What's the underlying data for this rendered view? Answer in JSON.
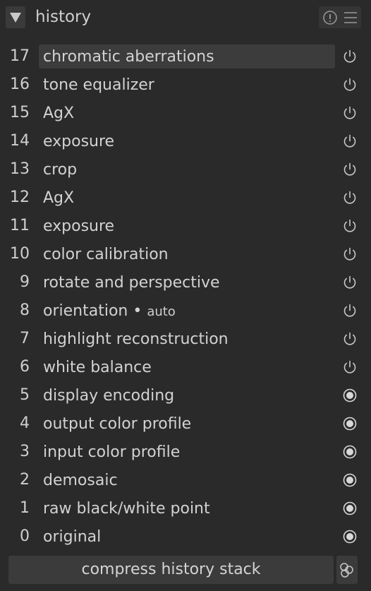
{
  "header": {
    "title": "history",
    "collapse_icon": "triangle-down-icon",
    "info_icon": "info-icon",
    "menu_icon": "hamburger-menu-icon"
  },
  "history": {
    "items": [
      {
        "num": "17",
        "label": "chromatic aberrations",
        "sub": "",
        "state": "power",
        "selected": true
      },
      {
        "num": "16",
        "label": "tone equalizer",
        "sub": "",
        "state": "power",
        "selected": false
      },
      {
        "num": "15",
        "label": "AgX",
        "sub": "",
        "state": "power",
        "selected": false
      },
      {
        "num": "14",
        "label": "exposure",
        "sub": "",
        "state": "power",
        "selected": false
      },
      {
        "num": "13",
        "label": "crop",
        "sub": "",
        "state": "power",
        "selected": false
      },
      {
        "num": "12",
        "label": "AgX",
        "sub": "",
        "state": "power",
        "selected": false
      },
      {
        "num": "11",
        "label": "exposure",
        "sub": "",
        "state": "power",
        "selected": false
      },
      {
        "num": "10",
        "label": "color calibration",
        "sub": "",
        "state": "power",
        "selected": false
      },
      {
        "num": "9",
        "label": "rotate and perspective",
        "sub": "",
        "state": "power",
        "selected": false
      },
      {
        "num": "8",
        "label": "orientation • ",
        "sub": "auto",
        "state": "power",
        "selected": false
      },
      {
        "num": "7",
        "label": "highlight reconstruction",
        "sub": "",
        "state": "power",
        "selected": false
      },
      {
        "num": "6",
        "label": "white balance",
        "sub": "",
        "state": "power",
        "selected": false
      },
      {
        "num": "5",
        "label": "display encoding",
        "sub": "",
        "state": "always-on",
        "selected": false
      },
      {
        "num": "4",
        "label": "output color profile",
        "sub": "",
        "state": "always-on",
        "selected": false
      },
      {
        "num": "3",
        "label": "input color profile",
        "sub": "",
        "state": "always-on",
        "selected": false
      },
      {
        "num": "2",
        "label": "demosaic",
        "sub": "",
        "state": "always-on",
        "selected": false
      },
      {
        "num": "1",
        "label": "raw black/white point",
        "sub": "",
        "state": "always-on",
        "selected": false
      },
      {
        "num": "0",
        "label": "original",
        "sub": "",
        "state": "always-on",
        "selected": false
      }
    ]
  },
  "footer": {
    "compress_label": "compress history stack",
    "styles_icon": "styles-icon"
  },
  "colors": {
    "background": "#2a2a2a",
    "selected_row": "#3c3c3c",
    "button": "#3b3b3b",
    "text": "#d2d2d2"
  }
}
